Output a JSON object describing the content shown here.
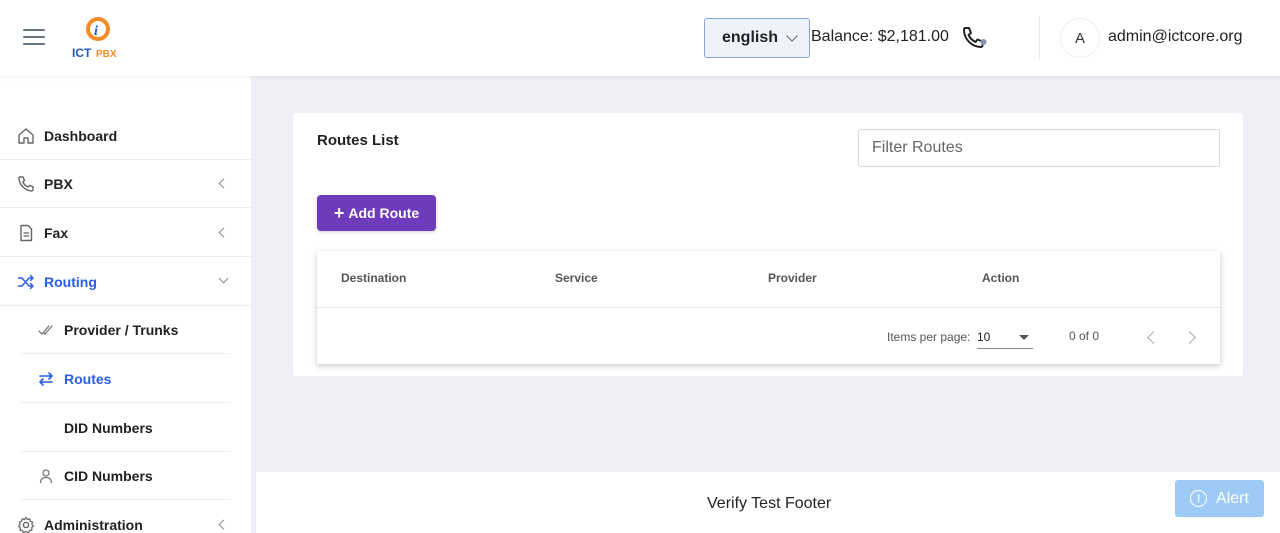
{
  "header": {
    "logo": "ICTPBX",
    "language": "english",
    "balance": "Balance: $2,181.00",
    "avatar_initial": "A",
    "user_email": "admin@ictcore.org"
  },
  "sidebar": {
    "items": [
      {
        "label": "Dashboard",
        "icon": "home-icon"
      },
      {
        "label": "PBX",
        "icon": "phone-icon"
      },
      {
        "label": "Fax",
        "icon": "document-icon"
      },
      {
        "label": "Routing",
        "icon": "shuffle-icon"
      },
      {
        "label": "Administration",
        "icon": "gear-icon"
      }
    ],
    "routing_sub": [
      {
        "label": "Provider / Trunks",
        "icon": "double-check-icon"
      },
      {
        "label": "Routes",
        "icon": "swap-icon"
      },
      {
        "label": "DID Numbers",
        "icon": ""
      },
      {
        "label": "CID Numbers",
        "icon": "person-icon"
      }
    ]
  },
  "main": {
    "title": "Routes List",
    "filter_placeholder": "Filter Routes",
    "add_button": "Add Route",
    "table": {
      "columns": [
        "Destination",
        "Service",
        "Provider",
        "Action"
      ],
      "rows": []
    },
    "pagination": {
      "items_per_page_label": "Items per page:",
      "items_per_page": "10",
      "range": "0 of 0"
    }
  },
  "footer": {
    "text": "Verify Test Footer"
  },
  "alert": {
    "label": "Alert"
  },
  "colors": {
    "accent": "#2a5ee8",
    "primary_button": "#6f3bbd",
    "alert": "#9ecbf6"
  }
}
